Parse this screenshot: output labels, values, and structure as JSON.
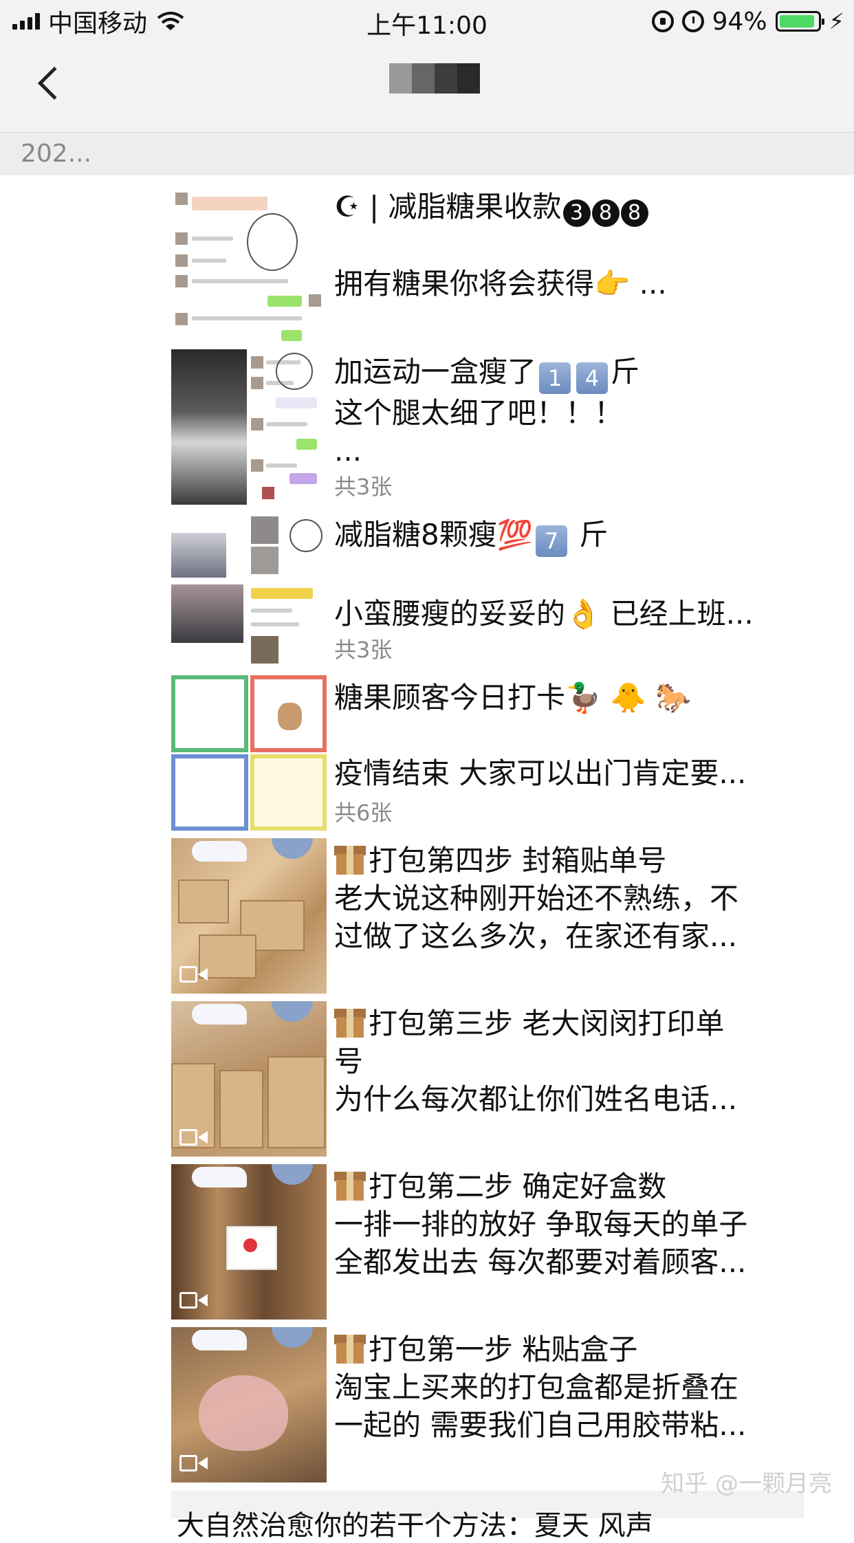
{
  "status_bar": {
    "carrier": "中国移动",
    "time": "上午11:00",
    "battery_percent": "94%",
    "battery_level": 0.94,
    "icons": [
      "signal-icon",
      "wifi-icon",
      "rotation-lock-icon",
      "alarm-icon",
      "battery-icon",
      "charging-icon"
    ]
  },
  "nav": {
    "back_icon": "chevron-left-icon",
    "title_pixelated": true
  },
  "year_label": "202...",
  "posts": [
    {
      "lines": [
        "☪ | 减脂糖果收款",
        "拥有糖果你将会获得👉 ..."
      ],
      "count": "",
      "kind": "image",
      "badge": "388"
    },
    {
      "lines": [
        "加运动一盒瘦了",
        "这个腿太细了吧！！！",
        "..."
      ],
      "count": "共3张",
      "kind": "images",
      "keycaps": [
        "1",
        "4"
      ],
      "unit": "斤"
    },
    {
      "lines": [
        "减脂糖8颗瘦💯",
        "小蛮腰瘦的妥妥的👌 已经上班..."
      ],
      "count": "共3张",
      "kind": "images",
      "keycap": "7",
      "unit": "斤"
    },
    {
      "lines": [
        "糖果顾客今日打卡🦆 🐥 🐎",
        "疫情结束 大家可以出门肯定要..."
      ],
      "count": "共6张",
      "kind": "images"
    },
    {
      "lines": [
        "打包第四步 封箱贴单号",
        "老大说这种刚开始还不熟练，不",
        "过做了这么多次，在家还有家..."
      ],
      "count": "",
      "kind": "video"
    },
    {
      "lines": [
        "打包第三步 老大闵闵打印单",
        "号",
        "为什么每次都让你们姓名电话..."
      ],
      "count": "",
      "kind": "video"
    },
    {
      "lines": [
        "打包第二步 确定好盒数",
        "一排一排的放好 争取每天的单子",
        "全都发出去 每次都要对着顾客..."
      ],
      "count": "",
      "kind": "video"
    },
    {
      "lines": [
        "打包第一步 粘贴盒子",
        "淘宝上买来的打包盒都是折叠在",
        "一起的 需要我们自己用胶带粘..."
      ],
      "count": "",
      "kind": "video"
    }
  ],
  "bottom_partial_text": "大自然治愈你的若干个方法：夏天 风声",
  "watermark": "知乎 @一颗月亮"
}
